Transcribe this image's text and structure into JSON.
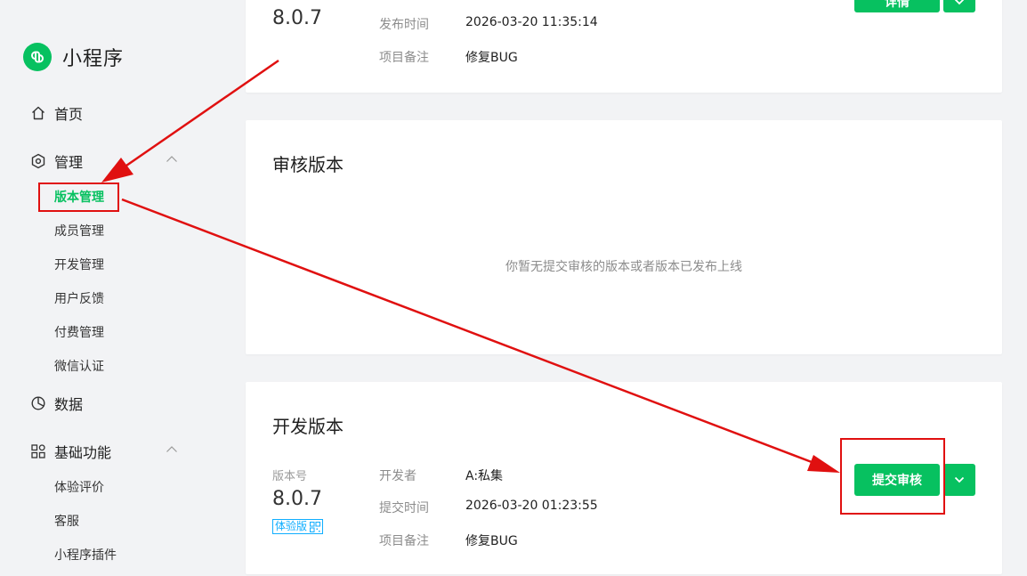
{
  "brand": {
    "name": "小程序",
    "icon": "mini-program-logo-icon",
    "color": "#07c160"
  },
  "nav": {
    "home": {
      "label": "首页",
      "icon": "home-icon"
    },
    "manage": {
      "label": "管理",
      "icon": "hexagon-settings-icon",
      "expanded": true,
      "items": [
        "版本管理",
        "成员管理",
        "开发管理",
        "用户反馈",
        "付费管理",
        "微信认证"
      ],
      "active": "版本管理"
    },
    "data": {
      "label": "数据",
      "icon": "pie-chart-icon"
    },
    "basic": {
      "label": "基础功能",
      "icon": "grid-icon",
      "expanded": true,
      "items": [
        "体验评价",
        "客服",
        "小程序插件"
      ]
    }
  },
  "online_version": {
    "version": "8.0.7",
    "publish_time_label": "发布时间",
    "publish_time": "2026-03-20 11:35:14",
    "remark_label": "项目备注",
    "remark": "修复BUG",
    "detail_button": "详情"
  },
  "review_version": {
    "title": "审核版本",
    "empty_text": "你暂无提交审核的版本或者版本已发布上线"
  },
  "dev_version": {
    "title": "开发版本",
    "version_label": "版本号",
    "version": "8.0.7",
    "badge": "体验版",
    "developer_label": "开发者",
    "developer": "A:私集",
    "submit_time_label": "提交时间",
    "submit_time": "2026-03-20 01:23:55",
    "remark_label": "项目备注",
    "remark": "修复BUG",
    "submit_button": "提交审核"
  },
  "annotation_color": "#e01010"
}
